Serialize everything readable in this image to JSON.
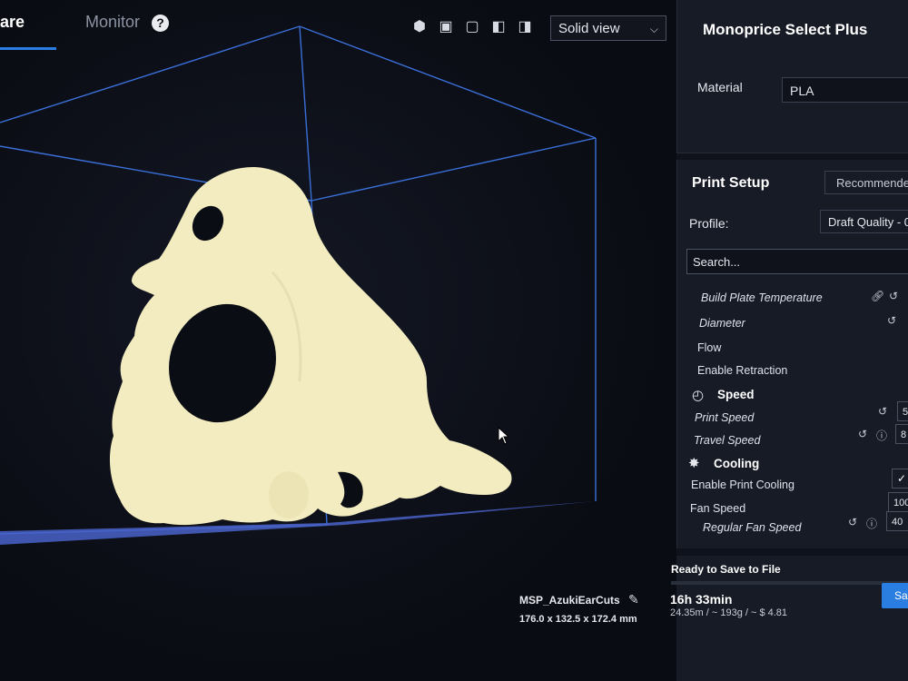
{
  "tabs": {
    "prepare": "are",
    "monitor": "Monitor",
    "help_icon": "?"
  },
  "view_select": {
    "value": "Solid view"
  },
  "view_icons": [
    "3d-view-icon",
    "front-view-icon",
    "top-view-icon",
    "left-view-icon",
    "right-view-icon"
  ],
  "model": {
    "name": "MSP_AzukiEarCuts",
    "dimensions": "176.0 x 132.5 x 172.4 mm"
  },
  "printer": {
    "name": "Monoprice Select Plus",
    "material_label": "Material",
    "material_value": "PLA"
  },
  "print_setup": {
    "title": "Print Setup",
    "mode": "Recommende",
    "profile_label": "Profile:",
    "profile_value": "Draft Quality - 0",
    "search_placeholder": "Search...",
    "settings": {
      "build_plate_temp": "Build Plate Temperature",
      "diameter": "Diameter",
      "flow": "Flow",
      "enable_retraction": "Enable Retraction",
      "speed_category": "Speed",
      "print_speed": "Print Speed",
      "print_speed_value": "5",
      "travel_speed": "Travel Speed",
      "travel_speed_value": "8",
      "cooling_category": "Cooling",
      "enable_print_cooling": "Enable Print Cooling",
      "fan_speed": "Fan Speed",
      "fan_speed_value": "100",
      "regular_fan_speed": "Regular Fan Speed",
      "regular_fan_speed_value": "40"
    }
  },
  "save": {
    "title": "Ready to Save to File",
    "time": "16h 33min",
    "usage": "24.35m / ~ 193g / ~ $ 4.81",
    "button": "Sa"
  },
  "colors": {
    "accent": "#2a7de1",
    "model": "#f3ecc0",
    "build_volume": "#3a6fd8"
  }
}
